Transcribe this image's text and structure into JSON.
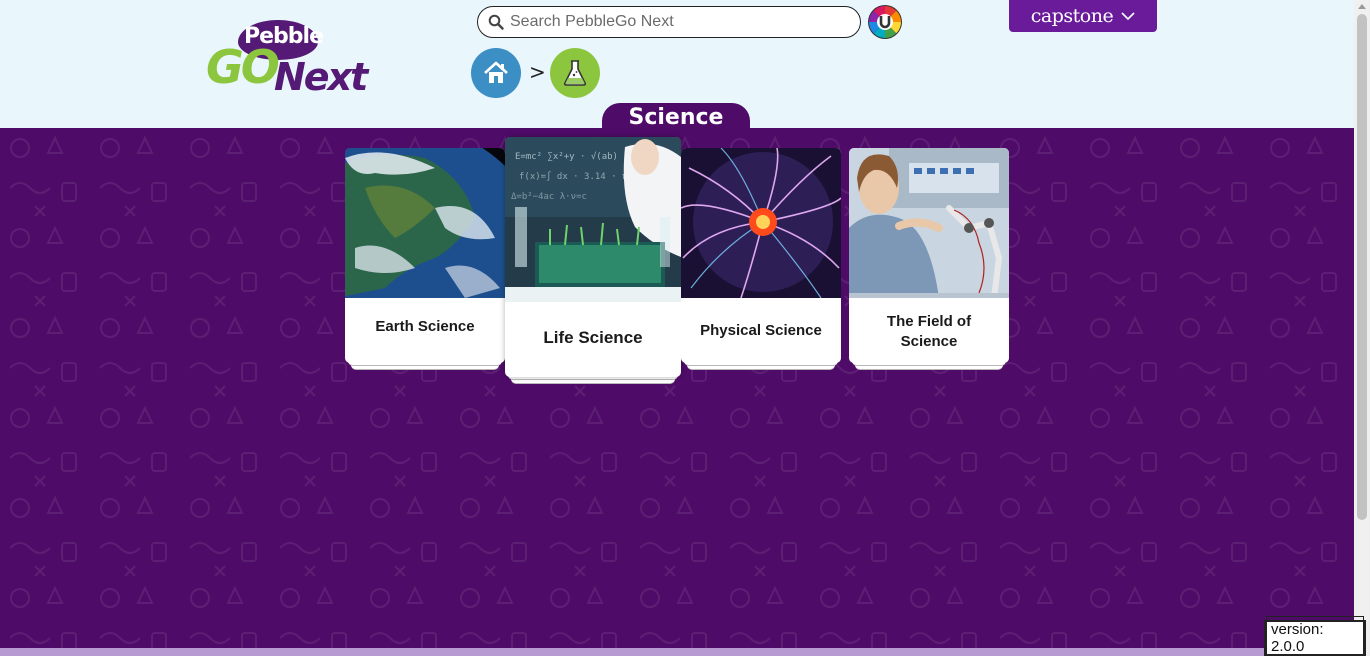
{
  "header": {
    "logo": {
      "top": "Pebble",
      "go": "GO",
      "next": "Next"
    },
    "search": {
      "placeholder": "Search PebbleGo Next",
      "value": ""
    },
    "brand_menu": {
      "label": "capstone"
    },
    "breadcrumb": {
      "home_icon": "home-icon",
      "separator": ">",
      "current_icon": "flask-icon"
    }
  },
  "section": {
    "title": "Science"
  },
  "cards": [
    {
      "label": "Earth Science",
      "image": "earth-from-space"
    },
    {
      "label": "Life Science",
      "image": "lab-seedlings"
    },
    {
      "label": "Physical Science",
      "image": "plasma-ball"
    },
    {
      "label": "The Field of Science",
      "image": "scientist-robot-arm"
    }
  ],
  "footer": {
    "version": "version: 2.0.0"
  },
  "colors": {
    "brand_purple": "#4f0b68",
    "header_bg": "#e9f6fb",
    "home_blue": "#3b8fc4",
    "science_green": "#8cc63f",
    "capstone_purple": "#6a1b9a"
  }
}
